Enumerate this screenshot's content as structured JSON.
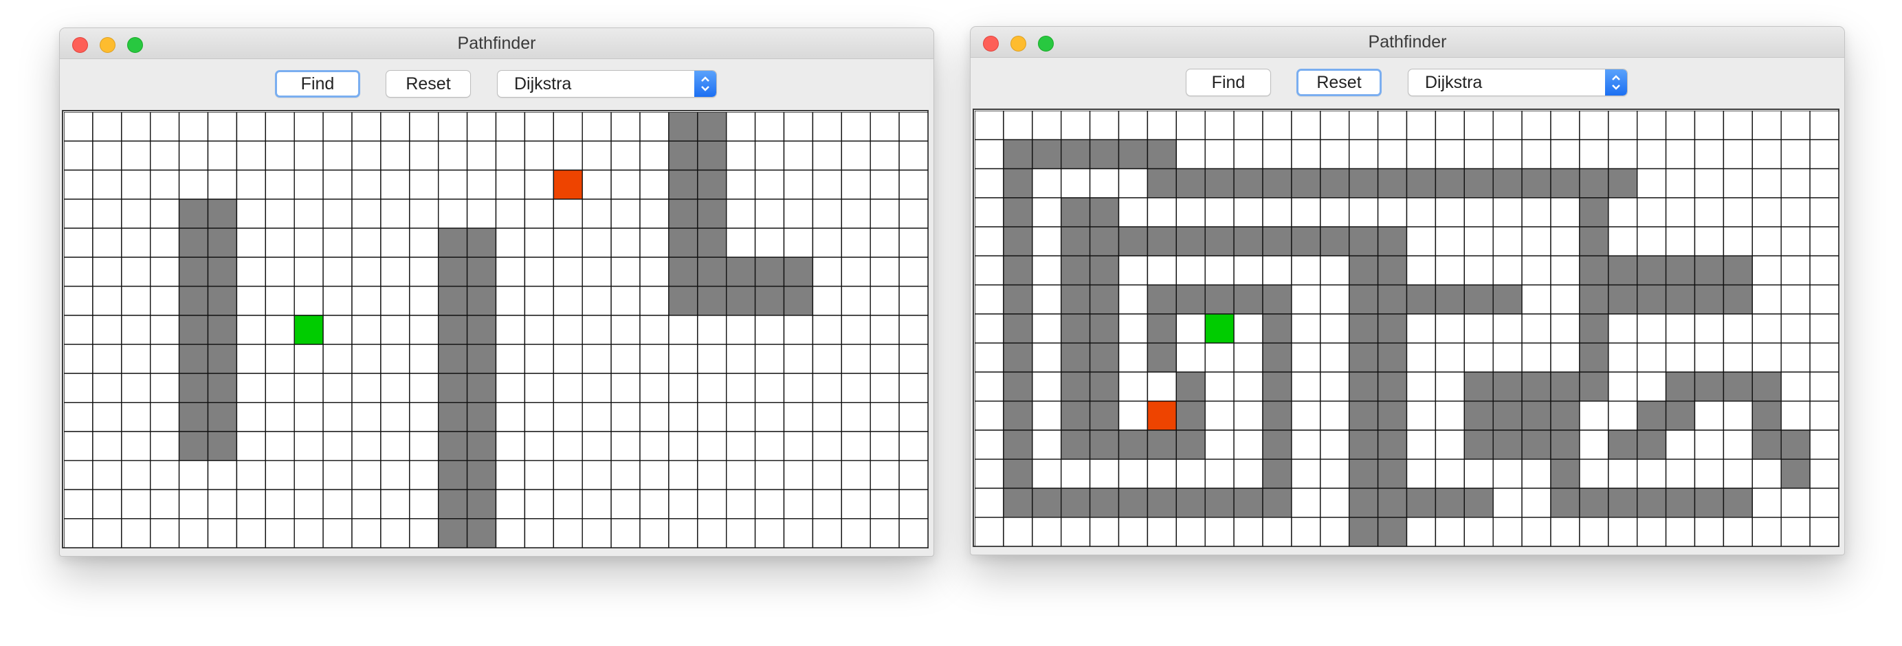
{
  "colors": {
    "wall": "#808080",
    "start": "#00cc00",
    "end": "#ee4400",
    "empty": "#ffffff",
    "gridline": "#111111"
  },
  "grid": {
    "cols": 30,
    "rows": 15
  },
  "windows": [
    {
      "title": "Pathfinder",
      "toolbar": {
        "find_label": "Find",
        "reset_label": "Reset",
        "algorithm": "Dijkstra",
        "focused": "find"
      },
      "start": [
        8,
        7
      ],
      "end": [
        17,
        2
      ],
      "walls": [
        [
          4,
          3
        ],
        [
          5,
          3
        ],
        [
          4,
          4
        ],
        [
          5,
          4
        ],
        [
          4,
          5
        ],
        [
          5,
          5
        ],
        [
          4,
          6
        ],
        [
          5,
          6
        ],
        [
          4,
          7
        ],
        [
          5,
          7
        ],
        [
          4,
          8
        ],
        [
          5,
          8
        ],
        [
          4,
          9
        ],
        [
          5,
          9
        ],
        [
          4,
          10
        ],
        [
          5,
          10
        ],
        [
          4,
          11
        ],
        [
          5,
          11
        ],
        [
          13,
          4
        ],
        [
          14,
          4
        ],
        [
          13,
          5
        ],
        [
          14,
          5
        ],
        [
          13,
          6
        ],
        [
          14,
          6
        ],
        [
          13,
          7
        ],
        [
          14,
          7
        ],
        [
          13,
          8
        ],
        [
          14,
          8
        ],
        [
          13,
          9
        ],
        [
          14,
          9
        ],
        [
          13,
          10
        ],
        [
          14,
          10
        ],
        [
          13,
          11
        ],
        [
          14,
          11
        ],
        [
          13,
          12
        ],
        [
          14,
          12
        ],
        [
          13,
          13
        ],
        [
          14,
          13
        ],
        [
          13,
          14
        ],
        [
          14,
          14
        ],
        [
          21,
          0
        ],
        [
          22,
          0
        ],
        [
          21,
          1
        ],
        [
          22,
          1
        ],
        [
          21,
          2
        ],
        [
          22,
          2
        ],
        [
          21,
          3
        ],
        [
          22,
          3
        ],
        [
          21,
          4
        ],
        [
          22,
          4
        ],
        [
          21,
          5
        ],
        [
          22,
          5
        ],
        [
          23,
          5
        ],
        [
          24,
          5
        ],
        [
          25,
          5
        ],
        [
          21,
          6
        ],
        [
          22,
          6
        ],
        [
          23,
          6
        ],
        [
          24,
          6
        ],
        [
          25,
          6
        ]
      ]
    },
    {
      "title": "Pathfinder",
      "toolbar": {
        "find_label": "Find",
        "reset_label": "Reset",
        "algorithm": "Dijkstra",
        "focused": "reset"
      },
      "start": [
        8,
        7
      ],
      "end": [
        6,
        10
      ],
      "walls": [
        [
          1,
          1
        ],
        [
          2,
          1
        ],
        [
          3,
          1
        ],
        [
          4,
          1
        ],
        [
          5,
          1
        ],
        [
          6,
          1
        ],
        [
          1,
          2
        ],
        [
          6,
          2
        ],
        [
          7,
          2
        ],
        [
          8,
          2
        ],
        [
          9,
          2
        ],
        [
          10,
          2
        ],
        [
          11,
          2
        ],
        [
          12,
          2
        ],
        [
          13,
          2
        ],
        [
          14,
          2
        ],
        [
          15,
          2
        ],
        [
          16,
          2
        ],
        [
          17,
          2
        ],
        [
          18,
          2
        ],
        [
          19,
          2
        ],
        [
          20,
          2
        ],
        [
          21,
          2
        ],
        [
          22,
          2
        ],
        [
          1,
          3
        ],
        [
          3,
          3
        ],
        [
          4,
          3
        ],
        [
          21,
          3
        ],
        [
          1,
          4
        ],
        [
          3,
          4
        ],
        [
          4,
          4
        ],
        [
          5,
          4
        ],
        [
          6,
          4
        ],
        [
          7,
          4
        ],
        [
          8,
          4
        ],
        [
          9,
          4
        ],
        [
          10,
          4
        ],
        [
          11,
          4
        ],
        [
          12,
          4
        ],
        [
          13,
          4
        ],
        [
          14,
          4
        ],
        [
          21,
          4
        ],
        [
          1,
          5
        ],
        [
          3,
          5
        ],
        [
          4,
          5
        ],
        [
          13,
          5
        ],
        [
          14,
          5
        ],
        [
          21,
          5
        ],
        [
          22,
          5
        ],
        [
          23,
          5
        ],
        [
          24,
          5
        ],
        [
          25,
          5
        ],
        [
          26,
          5
        ],
        [
          1,
          6
        ],
        [
          3,
          6
        ],
        [
          4,
          6
        ],
        [
          6,
          6
        ],
        [
          7,
          6
        ],
        [
          8,
          6
        ],
        [
          9,
          6
        ],
        [
          10,
          6
        ],
        [
          13,
          6
        ],
        [
          14,
          6
        ],
        [
          15,
          6
        ],
        [
          16,
          6
        ],
        [
          17,
          6
        ],
        [
          18,
          6
        ],
        [
          21,
          6
        ],
        [
          22,
          6
        ],
        [
          23,
          6
        ],
        [
          24,
          6
        ],
        [
          25,
          6
        ],
        [
          26,
          6
        ],
        [
          1,
          7
        ],
        [
          3,
          7
        ],
        [
          4,
          7
        ],
        [
          6,
          7
        ],
        [
          10,
          7
        ],
        [
          13,
          7
        ],
        [
          14,
          7
        ],
        [
          21,
          7
        ],
        [
          1,
          8
        ],
        [
          3,
          8
        ],
        [
          4,
          8
        ],
        [
          6,
          8
        ],
        [
          10,
          8
        ],
        [
          13,
          8
        ],
        [
          14,
          8
        ],
        [
          21,
          8
        ],
        [
          1,
          9
        ],
        [
          3,
          9
        ],
        [
          4,
          9
        ],
        [
          7,
          9
        ],
        [
          10,
          9
        ],
        [
          13,
          9
        ],
        [
          14,
          9
        ],
        [
          17,
          9
        ],
        [
          18,
          9
        ],
        [
          19,
          9
        ],
        [
          20,
          9
        ],
        [
          21,
          9
        ],
        [
          24,
          9
        ],
        [
          25,
          9
        ],
        [
          26,
          9
        ],
        [
          27,
          9
        ],
        [
          1,
          10
        ],
        [
          3,
          10
        ],
        [
          4,
          10
        ],
        [
          7,
          10
        ],
        [
          10,
          10
        ],
        [
          13,
          10
        ],
        [
          14,
          10
        ],
        [
          17,
          10
        ],
        [
          18,
          10
        ],
        [
          19,
          10
        ],
        [
          20,
          10
        ],
        [
          23,
          10
        ],
        [
          24,
          10
        ],
        [
          27,
          10
        ],
        [
          1,
          11
        ],
        [
          3,
          11
        ],
        [
          4,
          11
        ],
        [
          5,
          11
        ],
        [
          6,
          11
        ],
        [
          7,
          11
        ],
        [
          10,
          11
        ],
        [
          13,
          11
        ],
        [
          14,
          11
        ],
        [
          17,
          11
        ],
        [
          18,
          11
        ],
        [
          19,
          11
        ],
        [
          20,
          11
        ],
        [
          22,
          11
        ],
        [
          23,
          11
        ],
        [
          27,
          11
        ],
        [
          28,
          11
        ],
        [
          1,
          12
        ],
        [
          10,
          12
        ],
        [
          13,
          12
        ],
        [
          14,
          12
        ],
        [
          20,
          12
        ],
        [
          28,
          12
        ],
        [
          1,
          13
        ],
        [
          2,
          13
        ],
        [
          3,
          13
        ],
        [
          4,
          13
        ],
        [
          5,
          13
        ],
        [
          6,
          13
        ],
        [
          7,
          13
        ],
        [
          8,
          13
        ],
        [
          9,
          13
        ],
        [
          10,
          13
        ],
        [
          13,
          13
        ],
        [
          14,
          13
        ],
        [
          15,
          13
        ],
        [
          16,
          13
        ],
        [
          17,
          13
        ],
        [
          20,
          13
        ],
        [
          21,
          13
        ],
        [
          22,
          13
        ],
        [
          23,
          13
        ],
        [
          24,
          13
        ],
        [
          25,
          13
        ],
        [
          26,
          13
        ],
        [
          13,
          14
        ],
        [
          14,
          14
        ]
      ]
    }
  ]
}
